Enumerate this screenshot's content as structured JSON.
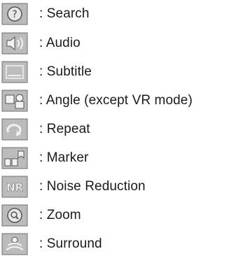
{
  "legend": {
    "items": [
      {
        "icon": "search-icon",
        "label": ": Search"
      },
      {
        "icon": "audio-icon",
        "label": ": Audio"
      },
      {
        "icon": "subtitle-icon",
        "label": ": Subtitle"
      },
      {
        "icon": "angle-icon",
        "label": ": Angle (except VR mode)"
      },
      {
        "icon": "repeat-icon",
        "label": ": Repeat"
      },
      {
        "icon": "marker-icon",
        "label": ": Marker"
      },
      {
        "icon": "noise-reduction-icon",
        "label": ": Noise Reduction",
        "icon_text": "NR"
      },
      {
        "icon": "zoom-icon",
        "label": ": Zoom"
      },
      {
        "icon": "surround-icon",
        "label": ": Surround"
      }
    ]
  }
}
